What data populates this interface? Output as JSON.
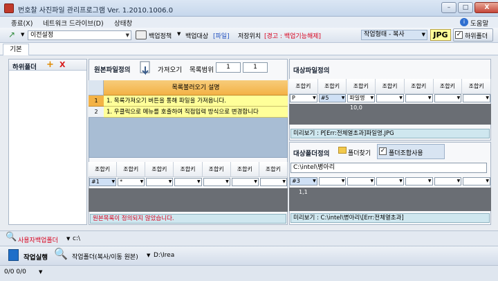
{
  "window": {
    "title": "번호찰 사진파일 관리프로그램 Ver. 1.2010.1006.0",
    "minimize": "–",
    "maximize": "□",
    "close": "X"
  },
  "menu": {
    "items": [
      "종료(X)",
      "네트워크 드라이브(D)",
      "상태창"
    ],
    "help": "도움말"
  },
  "toolbar": {
    "preset_value": "이전설정",
    "backup_policy": "백업정책",
    "backup_target_label": "백업대상",
    "backup_target_value": "[파일]",
    "storage_label": "저장위치",
    "storage_value": "[경고 : 백업기능해제]",
    "work_mode_value": "작업형태 - 복사",
    "ext_value": "JPG",
    "subfolder_label": "하위폴더"
  },
  "tabs": [
    "기본"
  ],
  "left_panel": {
    "title": "하위폴더",
    "add_symbol": "+",
    "remove_symbol": "X"
  },
  "source": {
    "title": "원본파일정의",
    "fetch_label": "가져오기",
    "range_label": "목록범위",
    "range_from": "1",
    "range_to": "1",
    "guide_header": "목록불러오기 설명",
    "guide_rows": [
      {
        "no": "1",
        "text": "1. 목록가져오기 버튼을 통해 파일을 가져옵니다."
      },
      {
        "no": "2",
        "text": "1. 우클릭으로 메뉴를 호출하여 직접입력 방식으로 변경합니다"
      }
    ],
    "col_header": "조합키",
    "combo_values": [
      "#1",
      "*",
      "",
      "",
      "",
      "",
      "",
      ""
    ],
    "status": "원본목록이 정의되지 않았습니다."
  },
  "target_file": {
    "title": "대상파일정의",
    "col_header": "조합키",
    "combo_values": [
      "P",
      "#5",
      "파일명",
      "",
      "",
      "",
      ""
    ],
    "sample_value": "10,0",
    "preview": "미리보기 : P[Err:전체열초과]파일명.JPG"
  },
  "target_folder": {
    "title": "대상폴더정의",
    "find_label": "폴더찾기",
    "combine_label": "폴더조합사용",
    "path_value": "C:\\intel\\병아리",
    "col_header": "조합키",
    "combo_values": [
      "#3",
      "",
      "",
      "",
      "",
      "",
      ""
    ],
    "sample_value": "1,1",
    "preview": "미리보기 : C:\\intel\\병아리\\[Err:전체열초과]"
  },
  "bottom": {
    "user_backup_label": "사용자백업폴더",
    "user_backup_value": "c:\\",
    "run_label": "작업실행",
    "work_folder_label": "작업폴더(복사/이동 원본)",
    "work_folder_value": "D:\\Irea",
    "status": "0/0 0/0"
  },
  "colors": {
    "accent_yellow": "#ffff99",
    "grid_blue": "#a8bdd4",
    "info_bar": "#cfe7ef",
    "warning_red": "#d8001c",
    "guide_header": "#f3b246"
  }
}
